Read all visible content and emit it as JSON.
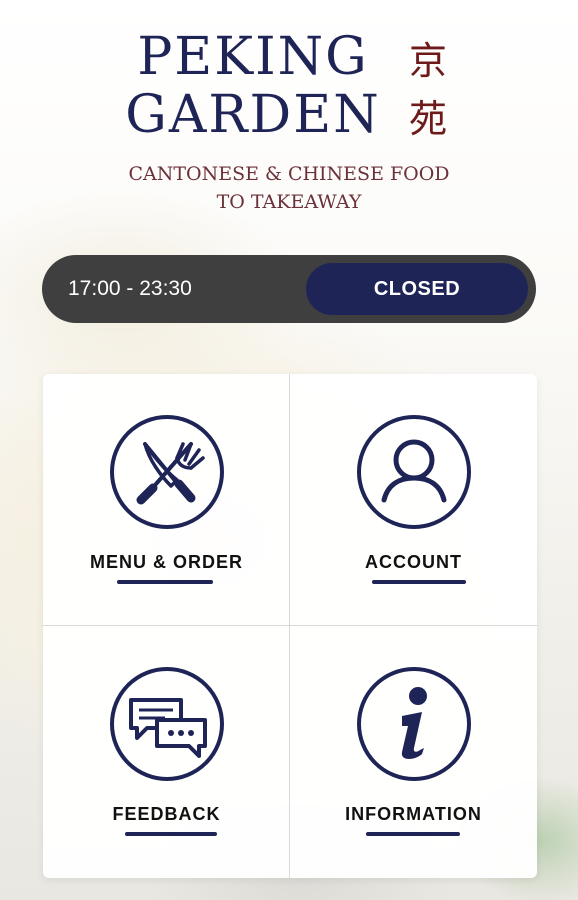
{
  "brand": {
    "name_line1": "PEKING",
    "name_line2": "GARDEN",
    "chinese_char1": "京",
    "chinese_char2": "苑",
    "tagline_line1": "CANTONESE & CHINESE FOOD",
    "tagline_line2": "TO TAKEAWAY"
  },
  "status": {
    "hours": "17:00 - 23:30",
    "state": "CLOSED"
  },
  "menu": {
    "tiles": [
      {
        "label": "MENU & ORDER",
        "icon": "knife-fork-icon"
      },
      {
        "label": "ACCOUNT",
        "icon": "user-icon"
      },
      {
        "label": "FEEDBACK",
        "icon": "chat-bubbles-icon"
      },
      {
        "label": "INFORMATION",
        "icon": "info-icon"
      }
    ]
  },
  "colors": {
    "brand_navy": "#1f2457",
    "chinese_red": "#6e1a1a",
    "status_bar_bg": "#3f3f3f"
  }
}
